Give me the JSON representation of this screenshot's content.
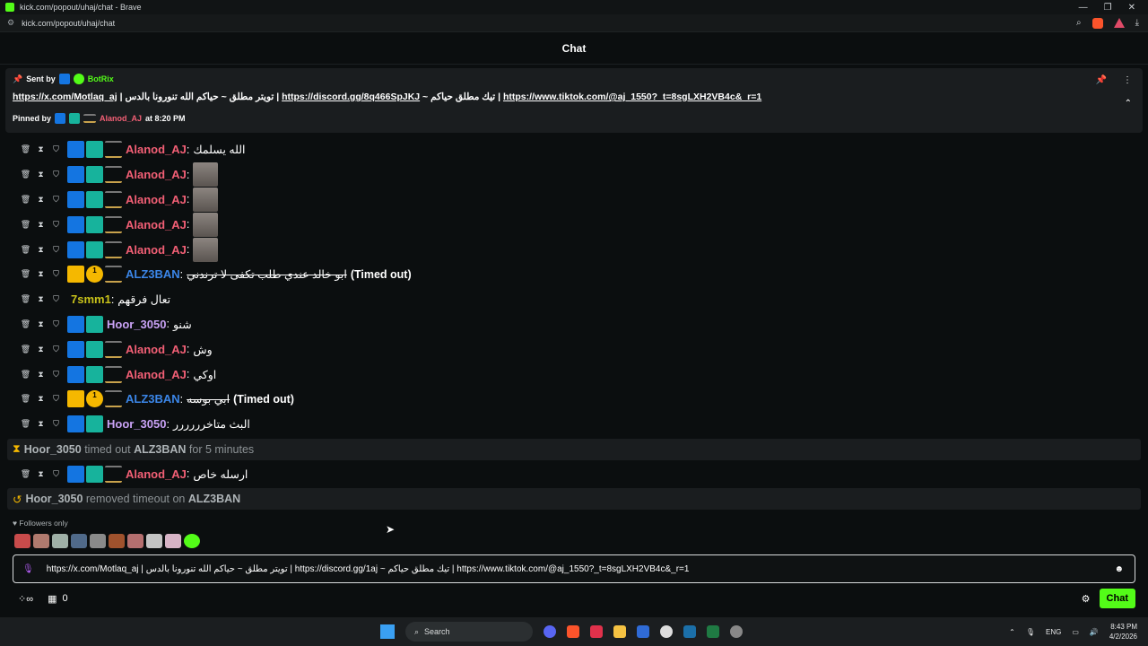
{
  "browser": {
    "window_title": "kick.com/popout/uhaj/chat - Brave",
    "url": "kick.com/popout/uhaj/chat"
  },
  "header": {
    "title": "Chat"
  },
  "pinned": {
    "sent_by_label": "Sent by",
    "sender": "BotRix",
    "link1": "https://x.com/Motlaq_aj",
    "text1": " | تويتر مطلق ~ حياكم الله تنورونا بالدس | ",
    "link2": "https://discord.gg/8q466SpJKJ",
    "text2": " ~ تيك مطلق حياكم | ",
    "link3": "https://www.tiktok.com/@aj_1550?_t=8sgLXH2VB4c&_r=1",
    "pinned_by_label": "Pinned by",
    "pinned_by_user": "Alanod_AJ",
    "pinned_time": "at 8:20 PM"
  },
  "messages": [
    {
      "user": "Alanod_AJ",
      "color": "#f25f75",
      "text": "الله يسلمك",
      "emote": false,
      "badges": [
        "mod",
        "vip",
        "og"
      ]
    },
    {
      "user": "Alanod_AJ",
      "color": "#f25f75",
      "text": "",
      "emote": true,
      "badges": [
        "mod",
        "vip",
        "og"
      ]
    },
    {
      "user": "Alanod_AJ",
      "color": "#f25f75",
      "text": "",
      "emote": true,
      "badges": [
        "mod",
        "vip",
        "og"
      ]
    },
    {
      "user": "Alanod_AJ",
      "color": "#f25f75",
      "text": "",
      "emote": true,
      "badges": [
        "mod",
        "vip",
        "og"
      ]
    },
    {
      "user": "Alanod_AJ",
      "color": "#f25f75",
      "text": "",
      "emote": true,
      "badges": [
        "mod",
        "vip",
        "og"
      ]
    },
    {
      "user": "ALZ3BAN",
      "color": "#3b86e8",
      "text": "ابو خالد عندي طلب تكفى لا ترندني",
      "strike": true,
      "timed": "(Timed out)",
      "badges": [
        "crown",
        "sub",
        "og"
      ]
    },
    {
      "user": "7smm1",
      "color": "#c8c21a",
      "text": "تعال فرقهم",
      "badges": []
    },
    {
      "user": "Hoor_3050",
      "color": "#c9a2f5",
      "text": "شنو",
      "badges": [
        "mod",
        "vip"
      ]
    },
    {
      "user": "Alanod_AJ",
      "color": "#f25f75",
      "text": "وش",
      "badges": [
        "mod",
        "vip",
        "og"
      ]
    },
    {
      "user": "Alanod_AJ",
      "color": "#f25f75",
      "text": "اوكي",
      "badges": [
        "mod",
        "vip",
        "og"
      ]
    },
    {
      "user": "ALZ3BAN",
      "color": "#3b86e8",
      "text": "ابي بوسه",
      "strike": true,
      "timed": "(Timed out)",
      "badges": [
        "crown",
        "sub",
        "og"
      ]
    },
    {
      "user": "Hoor_3050",
      "color": "#c9a2f5",
      "text": "البث متاخرررررر",
      "badges": [
        "mod",
        "vip"
      ]
    }
  ],
  "system1": {
    "actor": "Hoor_3050",
    "middle": " timed out ",
    "target": "ALZ3BAN",
    "tail": " for 5 minutes"
  },
  "after_msg": {
    "user": "Alanod_AJ",
    "color": "#f25f75",
    "text": "ارسله خاص",
    "badges": [
      "mod",
      "vip",
      "og"
    ]
  },
  "system2": {
    "actor": "Hoor_3050",
    "middle": " removed timeout on ",
    "target": "ALZ3BAN"
  },
  "footer": {
    "followers_label": "Followers only",
    "input_value": "https://x.com/Motlaq_aj | تويتر مطلق ~ حياكم الله تنورونا بالدس | https://discord.gg/1aj ~ تيك مطلق حياكم | https://www.tiktok.com/@aj_1550?_t=8sgLXH2VB4c&_r=1",
    "points": "0",
    "chat_button": "Chat"
  },
  "taskbar": {
    "search_placeholder": "Search",
    "lang": "ENG",
    "time": "8:43 PM",
    "date": "4/2/2026"
  }
}
